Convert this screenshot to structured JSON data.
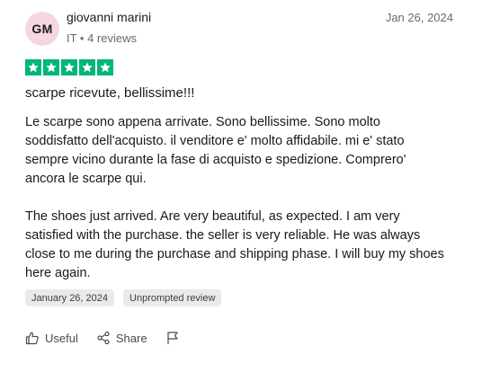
{
  "reviewer": {
    "initials": "GM",
    "name": "giovanni marini",
    "meta": "IT • 4 reviews",
    "avatar_color": "#f6d7df"
  },
  "review": {
    "date": "Jan 26, 2024",
    "rating": 5,
    "rating_color": "#00b67a",
    "title": "scarpe ricevute, bellissime!!!",
    "paragraphs": [
      "Le scarpe sono appena arrivate. Sono bellissime. Sono molto\nsoddisfatto dell'acquisto. il venditore e' molto affidabile. mi e' stato\nsempre vicino durante la fase di acquisto e spedizione. Comprero'\nancora le scarpe qui.",
      "The shoes just arrived. Are very beautiful, as expected. I am very\nsatisfied with the purchase. the seller is very reliable. He was always\nclose to me during the purchase and shipping phase. I will buy my shoes\nhere again."
    ]
  },
  "tags": [
    "January 26, 2024",
    "Unprompted review"
  ],
  "actions": {
    "useful_label": "Useful",
    "share_label": "Share",
    "useful_icon": "thumbs-up-icon",
    "share_icon": "share-icon",
    "flag_icon": "flag-icon"
  }
}
